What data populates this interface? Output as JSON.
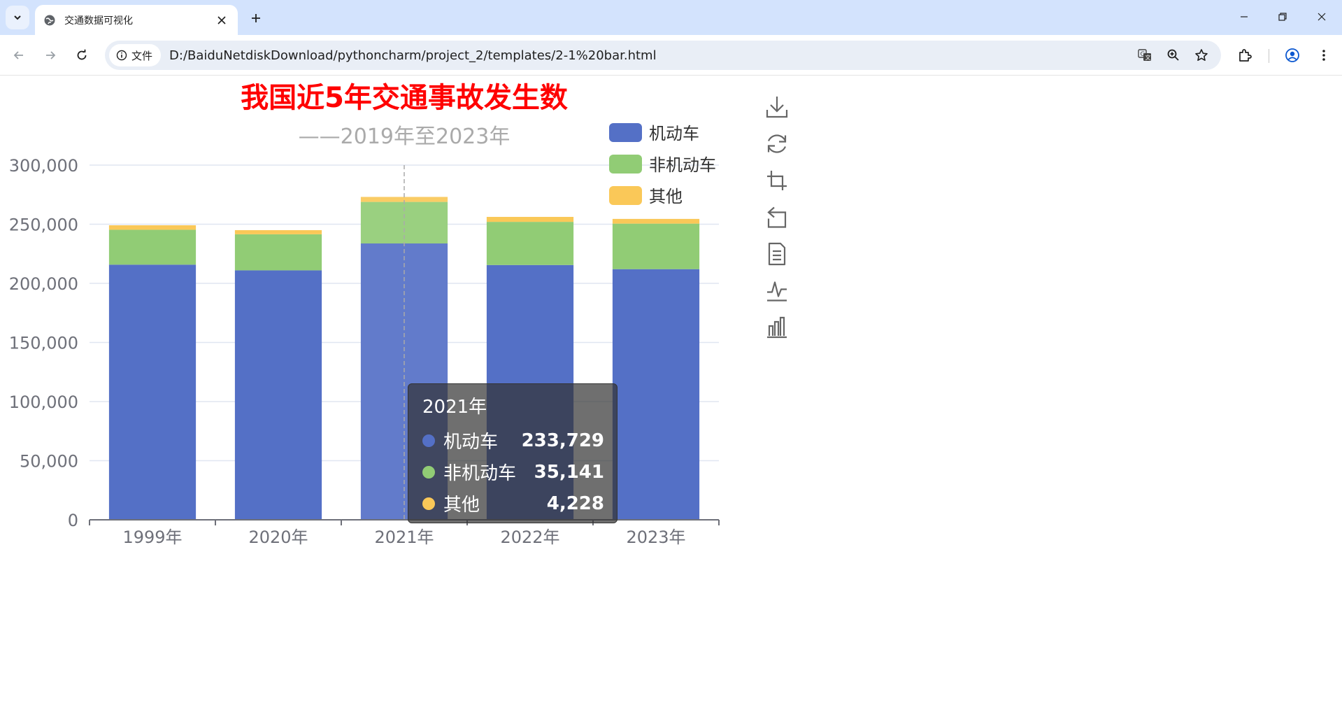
{
  "browser": {
    "tab_title": "交通数据可视化",
    "address_chip": "文件",
    "url": "D:/BaiduNetdiskDownload/pythoncharm/project_2/templates/2-1%20bar.html"
  },
  "colors": {
    "motor": "#5470c6",
    "nonmotor": "#91cc75",
    "other": "#fac858",
    "title": "#ff0000",
    "subtitle": "#aaaaaa"
  },
  "tooltip": {
    "header": "2021年",
    "rows": [
      {
        "name": "机动车",
        "value": "233,729",
        "color": "#5470c6"
      },
      {
        "name": "非机动车",
        "value": "35,141",
        "color": "#91cc75"
      },
      {
        "name": "其他",
        "value": "4,228",
        "color": "#fac858"
      }
    ]
  },
  "chart_data": {
    "type": "bar",
    "stacked": true,
    "title": "我国近5年交通事故发生数",
    "subtitle": "——2019年至2023年",
    "xlabel": "",
    "ylabel": "",
    "categories": [
      "1999年",
      "2020年",
      "2021年",
      "2022年",
      "2023年"
    ],
    "series": [
      {
        "name": "机动车",
        "color": "#5470c6",
        "values": [
          215800,
          211000,
          233729,
          215500,
          212000
        ]
      },
      {
        "name": "非机动车",
        "color": "#91cc75",
        "values": [
          29500,
          30500,
          35141,
          36500,
          38500
        ]
      },
      {
        "name": "其他",
        "color": "#fac858",
        "values": [
          3800,
          3500,
          4228,
          4200,
          4000
        ]
      }
    ],
    "ylim": [
      0,
      300000
    ],
    "yticks": [
      0,
      50000,
      100000,
      150000,
      200000,
      250000,
      300000
    ],
    "ytick_labels": [
      "0",
      "50,000",
      "100,000",
      "150,000",
      "200,000",
      "250,000",
      "300,000"
    ],
    "grid": true,
    "legend_position": "top-right",
    "highlighted_category": "2021年",
    "toolbox": [
      "download-icon",
      "restore-icon",
      "zoom-icon",
      "zoom-reset-icon",
      "data-view-icon",
      "line-chart-icon",
      "bar-chart-icon"
    ]
  }
}
